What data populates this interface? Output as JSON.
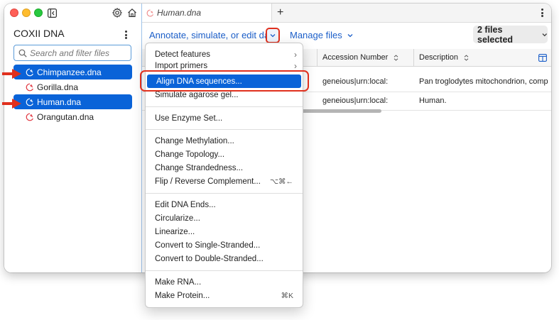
{
  "sidebar": {
    "title": "COXII DNA",
    "search_placeholder": "Search and filter files",
    "files": [
      {
        "label": "Chimpanzee.dna",
        "selected": true
      },
      {
        "label": "Gorilla.dna",
        "selected": false
      },
      {
        "label": "Human.dna",
        "selected": true
      },
      {
        "label": "Orangutan.dna",
        "selected": false
      }
    ]
  },
  "tabs": {
    "active_title": "Human.dna",
    "add_label": "+"
  },
  "toolbar": {
    "annotate_label": "Annotate, simulate, or edit data",
    "manage_label": "Manage files",
    "files_selected": "2 files selected"
  },
  "table": {
    "columns": [
      "Accession Number",
      "Description"
    ],
    "rows": [
      [
        "geneious|urn:local:",
        "Pan troglodytes mitochondrion, comp"
      ],
      [
        "geneious|urn:local:",
        "Human."
      ]
    ]
  },
  "menu": {
    "items": [
      {
        "label": "Detect features",
        "submenu": true
      },
      {
        "label": "Import primers",
        "submenu": true
      },
      {
        "label": "Align DNA sequences...",
        "active": true
      },
      {
        "label": "Simulate agarose gel..."
      },
      {
        "label": "Use Enzyme Set..."
      },
      {
        "label": "Change Methylation..."
      },
      {
        "label": "Change Topology..."
      },
      {
        "label": "Change Strandedness..."
      },
      {
        "label": "Flip / Reverse Complement...",
        "shortcut": "⌥⌘←"
      },
      {
        "label": "Edit DNA Ends..."
      },
      {
        "label": "Circularize..."
      },
      {
        "label": "Linearize..."
      },
      {
        "label": "Convert to Single-Stranded..."
      },
      {
        "label": "Convert to Double-Stranded..."
      },
      {
        "label": "Make RNA..."
      },
      {
        "label": "Make Protein...",
        "shortcut": "⌘K"
      }
    ]
  },
  "colors": {
    "accent": "#0a63d8",
    "link": "#1c5fc9",
    "highlight": "#e0301e",
    "dna_icon": "#e0303a"
  }
}
